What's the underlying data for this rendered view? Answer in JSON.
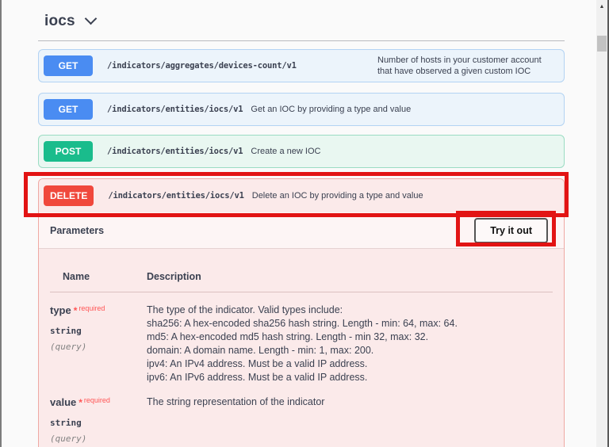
{
  "page": {
    "title": "iocs"
  },
  "icons": {
    "scroll_up": "▲",
    "chevron_down": "v"
  },
  "colors": {
    "get_badge": "#4a8cf2",
    "post_badge": "#1abc8c",
    "delete_badge": "#f0483c",
    "annotation_red": "#e21414",
    "required_red": "#f55555"
  },
  "endpoints": [
    {
      "method": "GET",
      "path": "/indicators/aggregates/devices-count/v1",
      "description": "Number of hosts in your customer account that have observed a given custom IOC"
    },
    {
      "method": "GET",
      "path": "/indicators/entities/iocs/v1",
      "description": "Get an IOC by providing a type and value"
    },
    {
      "method": "POST",
      "path": "/indicators/entities/iocs/v1",
      "description": "Create a new IOC"
    },
    {
      "method": "DELETE",
      "path": "/indicators/entities/iocs/v1",
      "description": "Delete an IOC by providing a type and value"
    }
  ],
  "parameters_section": {
    "title": "Parameters",
    "try_it_out_label": "Try it out",
    "table": {
      "columns": [
        "Name",
        "Description"
      ],
      "rows": [
        {
          "name": "type",
          "required_marker": "*",
          "required_label": "required",
          "data_type": "string",
          "location": "(query)",
          "description_lines": [
            "The type of the indicator. Valid types include:",
            "sha256: A hex-encoded sha256 hash string. Length - min: 64, max: 64.",
            "md5: A hex-encoded md5 hash string. Length - min 32, max: 32.",
            "domain: A domain name. Length - min: 1, max: 200.",
            "ipv4: An IPv4 address. Must be a valid IP address.",
            "ipv6: An IPv6 address. Must be a valid IP address."
          ]
        },
        {
          "name": "value",
          "required_marker": "*",
          "required_label": "required",
          "data_type": "string",
          "location": "(query)",
          "description_lines": [
            "The string representation of the indicator"
          ]
        }
      ]
    }
  }
}
